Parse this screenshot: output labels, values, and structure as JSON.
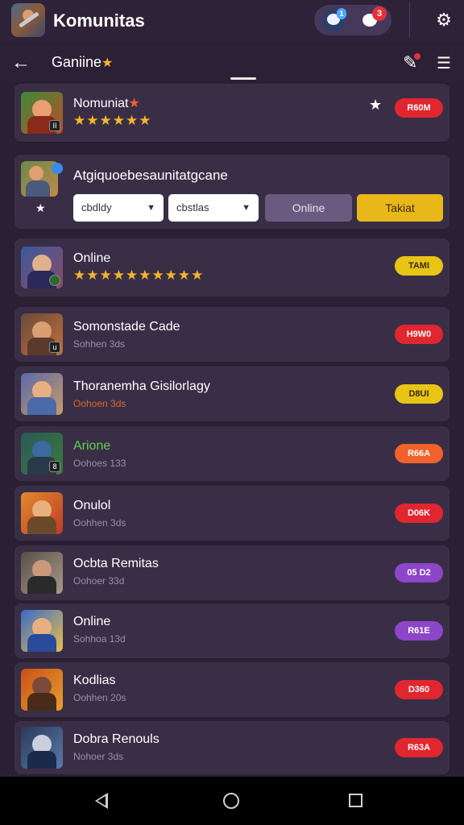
{
  "app": {
    "title": "Komunitas"
  },
  "header": {
    "chat_badge": "1",
    "notif_badge": "3",
    "icons": [
      "app-logo-icon",
      "chat-icon",
      "message-icon",
      "gear-icon"
    ]
  },
  "subheader": {
    "title": "Ganiine",
    "title_star": "★",
    "icons": [
      "back-arrow-icon",
      "mic-icon",
      "menu-icon"
    ]
  },
  "featured": {
    "title": "Nomuniat",
    "title_star": "★",
    "stars": "★★★★★★",
    "mini_badge": "II",
    "button": "R60M"
  },
  "filters": {
    "title": "Atgiquoebesaunitatgcane",
    "dropdown1": "cbdldy",
    "dropdown2": "cbstlas",
    "segment1": "Online",
    "segment2": "Takiat"
  },
  "online_card": {
    "title": "Online",
    "stars": "★★★★★★★★★★",
    "button": "TAMI"
  },
  "colors": {
    "bg": "#2a2033",
    "card": "#3a2e47",
    "red": "#e0262e",
    "yellow": "#e8c515",
    "orange": "#f0622a",
    "purple": "#8c46c8"
  },
  "rows": [
    {
      "title": "Somonstade Cade",
      "sub": "Sohhen 3ds",
      "button": "H9W0",
      "btn_color": "#e0262e",
      "title_color": "#ffffff",
      "sub_color": "#9a8fa6",
      "mini": "u"
    },
    {
      "title": "Thoranemha Gisilorlagy",
      "sub": "Oohoen 3ds",
      "button": "D8UI",
      "btn_color": "#e8c515",
      "title_color": "#ffffff",
      "sub_color": "#d46a2a",
      "mini": ""
    },
    {
      "title": "Arione",
      "sub": "Oohoes 133",
      "button": "R66A",
      "btn_color": "#f0622a",
      "title_color": "#5ed24a",
      "sub_color": "#9a8fa6",
      "mini": "8"
    },
    {
      "title": "Onulol",
      "sub": "Oohhen 3ds",
      "button": "D06K",
      "btn_color": "#e0262e",
      "title_color": "#ffffff",
      "sub_color": "#9a8fa6",
      "mini": ""
    },
    {
      "title": "Ocbta Remitas",
      "sub": "Oohoer 33d",
      "button": "05 D2",
      "btn_color": "#8c46c8",
      "title_color": "#ffffff",
      "sub_color": "#9a8fa6",
      "mini": ""
    },
    {
      "title": "Online",
      "sub": "Sohhoa 13d",
      "button": "R61E",
      "btn_color": "#8c46c8",
      "title_color": "#ffffff",
      "sub_color": "#9a8fa6",
      "mini": ""
    },
    {
      "title": "Kodlias",
      "sub": "Oohhen 20s",
      "button": "D360",
      "btn_color": "#e0262e",
      "title_color": "#ffffff",
      "sub_color": "#9a8fa6",
      "mini": ""
    },
    {
      "title": "Dobra Renouls",
      "sub": "Nohoer 3ds",
      "button": "R63A",
      "btn_color": "#e0262e",
      "title_color": "#ffffff",
      "sub_color": "#9a8fa6",
      "mini": ""
    }
  ],
  "nav": {
    "icons": [
      "nav-back-icon",
      "nav-home-icon",
      "nav-recents-icon"
    ]
  }
}
